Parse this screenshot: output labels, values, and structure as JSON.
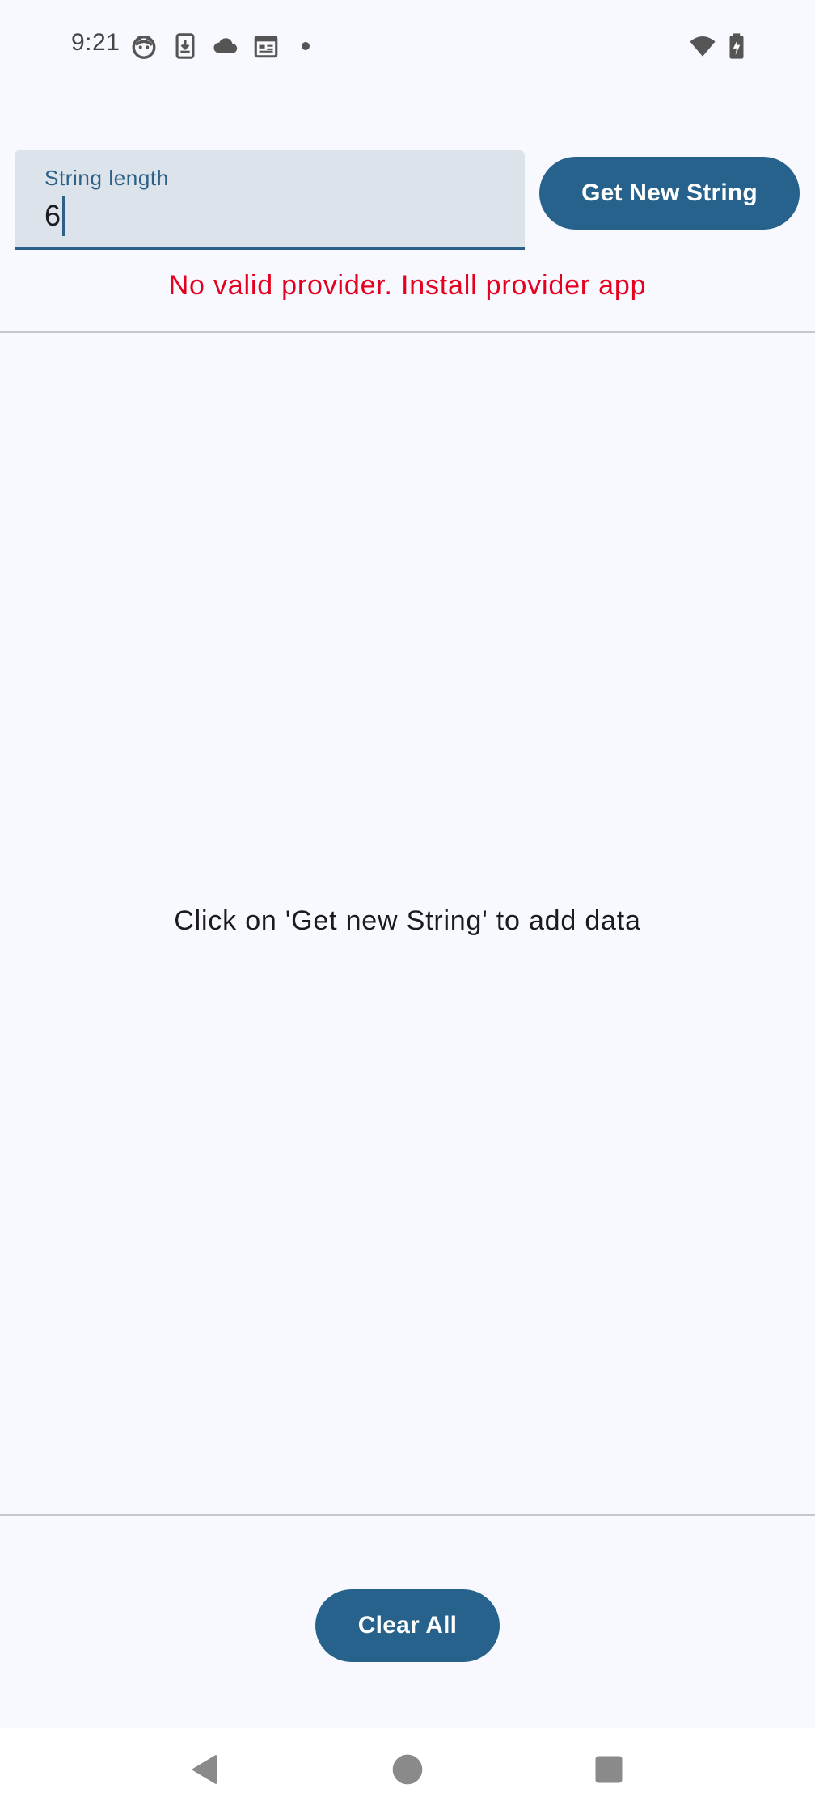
{
  "status_bar": {
    "time": "9:21",
    "icons": [
      "cat-face-icon",
      "download-phone-icon",
      "cloud-icon",
      "calendar-icon",
      "dot-icon"
    ],
    "right_icons": [
      "wifi-icon",
      "battery-charging-icon"
    ]
  },
  "input": {
    "label": "String length",
    "value": "6"
  },
  "buttons": {
    "get_new_string": "Get New String",
    "clear_all": "Clear All"
  },
  "error_message": "No valid provider. Install provider app",
  "empty_state": "Click on 'Get new String' to add data",
  "colors": {
    "primary": "#27628c",
    "error": "#e6001f",
    "background": "#f7f9fe",
    "field_background": "#dde3ea"
  },
  "navigation": {
    "icons": [
      "back-icon",
      "home-icon",
      "recents-icon"
    ]
  }
}
